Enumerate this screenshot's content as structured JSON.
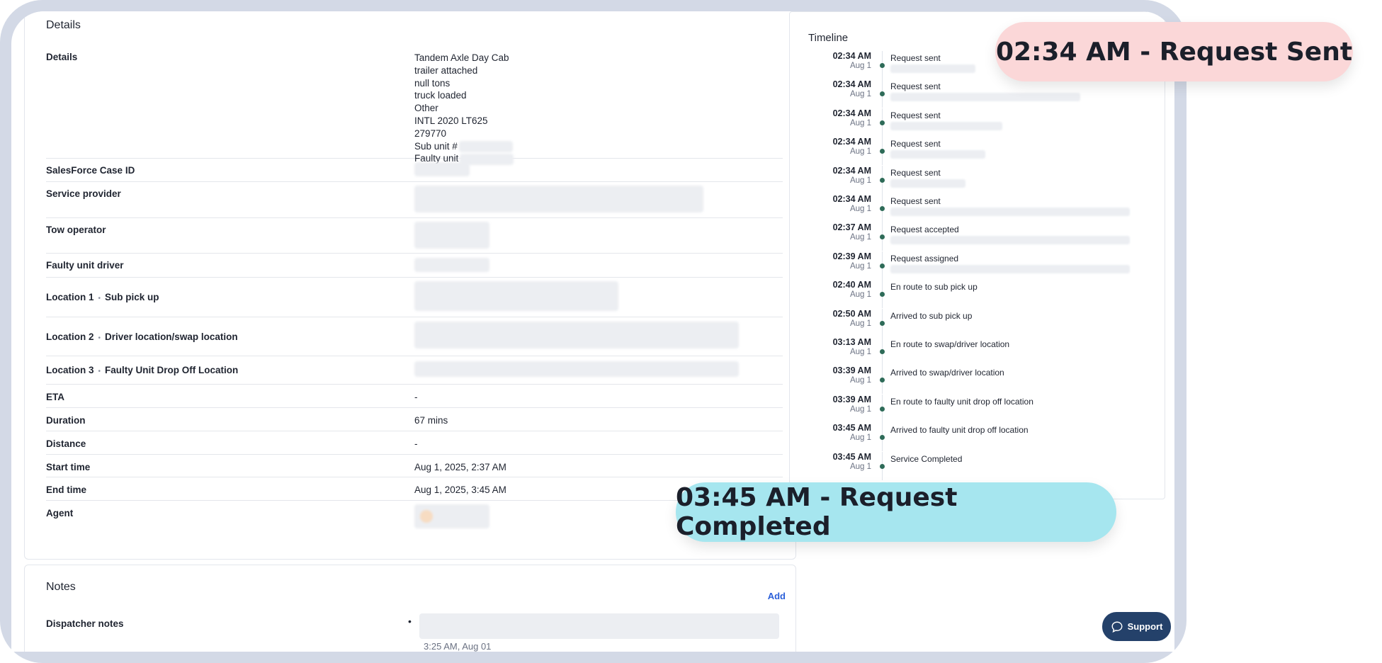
{
  "details": {
    "card_title": "Details",
    "rows": {
      "details": {
        "label": "Details",
        "lines": [
          "Tandem Axle Day Cab",
          "trailer attached",
          "null tons",
          "truck loaded",
          "Other",
          "INTL 2020 LT625",
          "279770",
          "Sub unit #",
          "Faulty unit"
        ]
      },
      "salesforce": {
        "label": "SalesForce Case ID"
      },
      "service_provider": {
        "label": "Service provider"
      },
      "tow_operator": {
        "label": "Tow operator"
      },
      "faulty_driver": {
        "label": "Faulty unit driver"
      },
      "location1": {
        "label_prefix": "Location 1",
        "sep": "•",
        "label_suffix": "Sub pick up"
      },
      "location2": {
        "label_prefix": "Location 2",
        "sep": "•",
        "label_suffix": "Driver location/swap location"
      },
      "location3": {
        "label_prefix": "Location 3",
        "sep": "•",
        "label_suffix": "Faulty Unit Drop Off Location"
      },
      "eta": {
        "label": "ETA",
        "value": "-"
      },
      "duration": {
        "label": "Duration",
        "value": "67 mins"
      },
      "distance": {
        "label": "Distance",
        "value": "-"
      },
      "start_time": {
        "label": "Start time",
        "value": "Aug 1, 2025, 2:37 AM"
      },
      "end_time": {
        "label": "End time",
        "value": "Aug 1, 2025, 3:45 AM"
      },
      "agent": {
        "label": "Agent"
      }
    }
  },
  "notes": {
    "title": "Notes",
    "add_label": "Add",
    "dispatcher_label": "Dispatcher notes",
    "note_time": "3:25 AM, Aug 01"
  },
  "timeline": {
    "title": "Timeline",
    "items": [
      {
        "time": "02:34 AM",
        "date": "Aug 1",
        "event": "Request sent",
        "has_sub": true
      },
      {
        "time": "02:34 AM",
        "date": "Aug 1",
        "event": "Request sent",
        "has_sub": true
      },
      {
        "time": "02:34 AM",
        "date": "Aug 1",
        "event": "Request sent",
        "has_sub": true
      },
      {
        "time": "02:34 AM",
        "date": "Aug 1",
        "event": "Request sent",
        "has_sub": true
      },
      {
        "time": "02:34 AM",
        "date": "Aug 1",
        "event": "Request sent",
        "has_sub": true
      },
      {
        "time": "02:34 AM",
        "date": "Aug 1",
        "event": "Request sent",
        "has_sub": true
      },
      {
        "time": "02:37 AM",
        "date": "Aug 1",
        "event": "Request accepted",
        "has_sub": true
      },
      {
        "time": "02:39 AM",
        "date": "Aug 1",
        "event": "Request assigned",
        "has_sub": true
      },
      {
        "time": "02:40 AM",
        "date": "Aug 1",
        "event": "En route to sub pick up",
        "has_sub": false
      },
      {
        "time": "02:50 AM",
        "date": "Aug 1",
        "event": "Arrived to sub pick up",
        "has_sub": false
      },
      {
        "time": "03:13 AM",
        "date": "Aug 1",
        "event": "En route to swap/driver location",
        "has_sub": false
      },
      {
        "time": "03:39 AM",
        "date": "Aug 1",
        "event": "Arrived to swap/driver location",
        "has_sub": false
      },
      {
        "time": "03:39 AM",
        "date": "Aug 1",
        "event": "En route to faulty unit drop off location",
        "has_sub": false
      },
      {
        "time": "03:45 AM",
        "date": "Aug 1",
        "event": "Arrived to faulty unit drop off location",
        "has_sub": false
      },
      {
        "time": "03:45 AM",
        "date": "Aug 1",
        "event": "Service Completed",
        "has_sub": false
      }
    ]
  },
  "callouts": {
    "sent": "02:34 AM - Request Sent",
    "completed": "03:45 AM - Request Completed"
  },
  "support": {
    "label": "Support"
  },
  "colors": {
    "frame": "#d3d9e6",
    "callout_sent": "#fbd7d8",
    "callout_completed": "#a6e6ef",
    "timeline_dot": "#2e6b58",
    "support_bg": "#24416a",
    "link": "#2b5fd9"
  }
}
